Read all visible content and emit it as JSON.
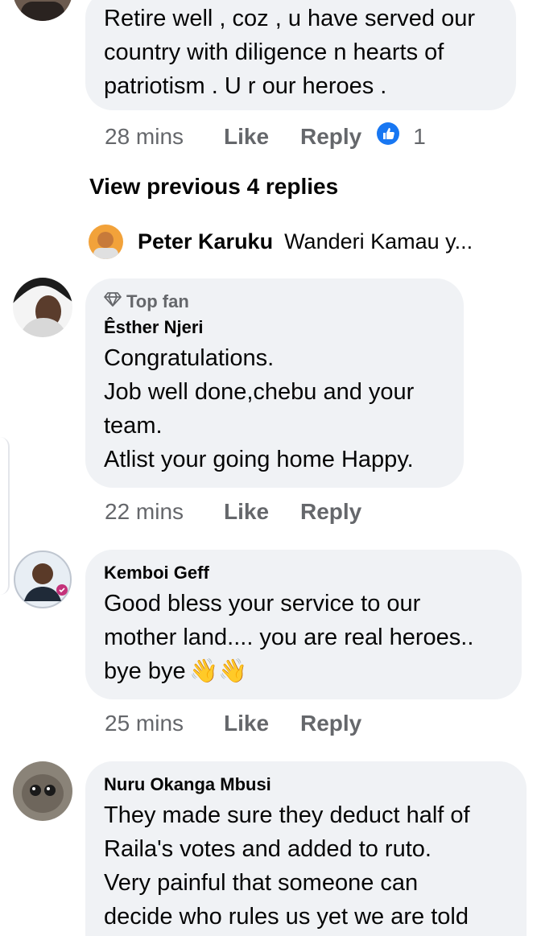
{
  "comments": [
    {
      "text": "Retire well , coz , u have served our\ncountry with diligence n  hearts of\npatriotism . U r our heroes .",
      "time": "28 mins",
      "like_label": "Like",
      "reply_label": "Reply",
      "reaction_icon": "like-thumb-icon",
      "reaction_count": "1"
    },
    {
      "badge": "Top fan",
      "name": "Êsther Njeri",
      "text": "Congratulations.\nJob well done,chebu and your\nteam.\nAtlist your going home Happy.",
      "time": "22 mins",
      "like_label": "Like",
      "reply_label": "Reply"
    },
    {
      "name": "Kemboi Geff",
      "text": "Good bless your service to our\nmother land.... you are real heroes..\nbye bye",
      "emoji": "👋👋",
      "time": "25 mins",
      "like_label": "Like",
      "reply_label": "Reply"
    },
    {
      "name": "Nuru Okanga Mbusi",
      "text": "They made sure they deduct half of\nRaila's votes and added to ruto.\nVery painful that someone can\ndecide who rules us yet we are told"
    }
  ],
  "view_previous": "View previous 4 replies",
  "reply_preview": {
    "name": "Peter Karuku",
    "text": "Wanderi Kamau y..."
  },
  "colors": {
    "bubble": "#f0f2f5",
    "meta": "#65676b",
    "like_blue": "#1877f2"
  }
}
